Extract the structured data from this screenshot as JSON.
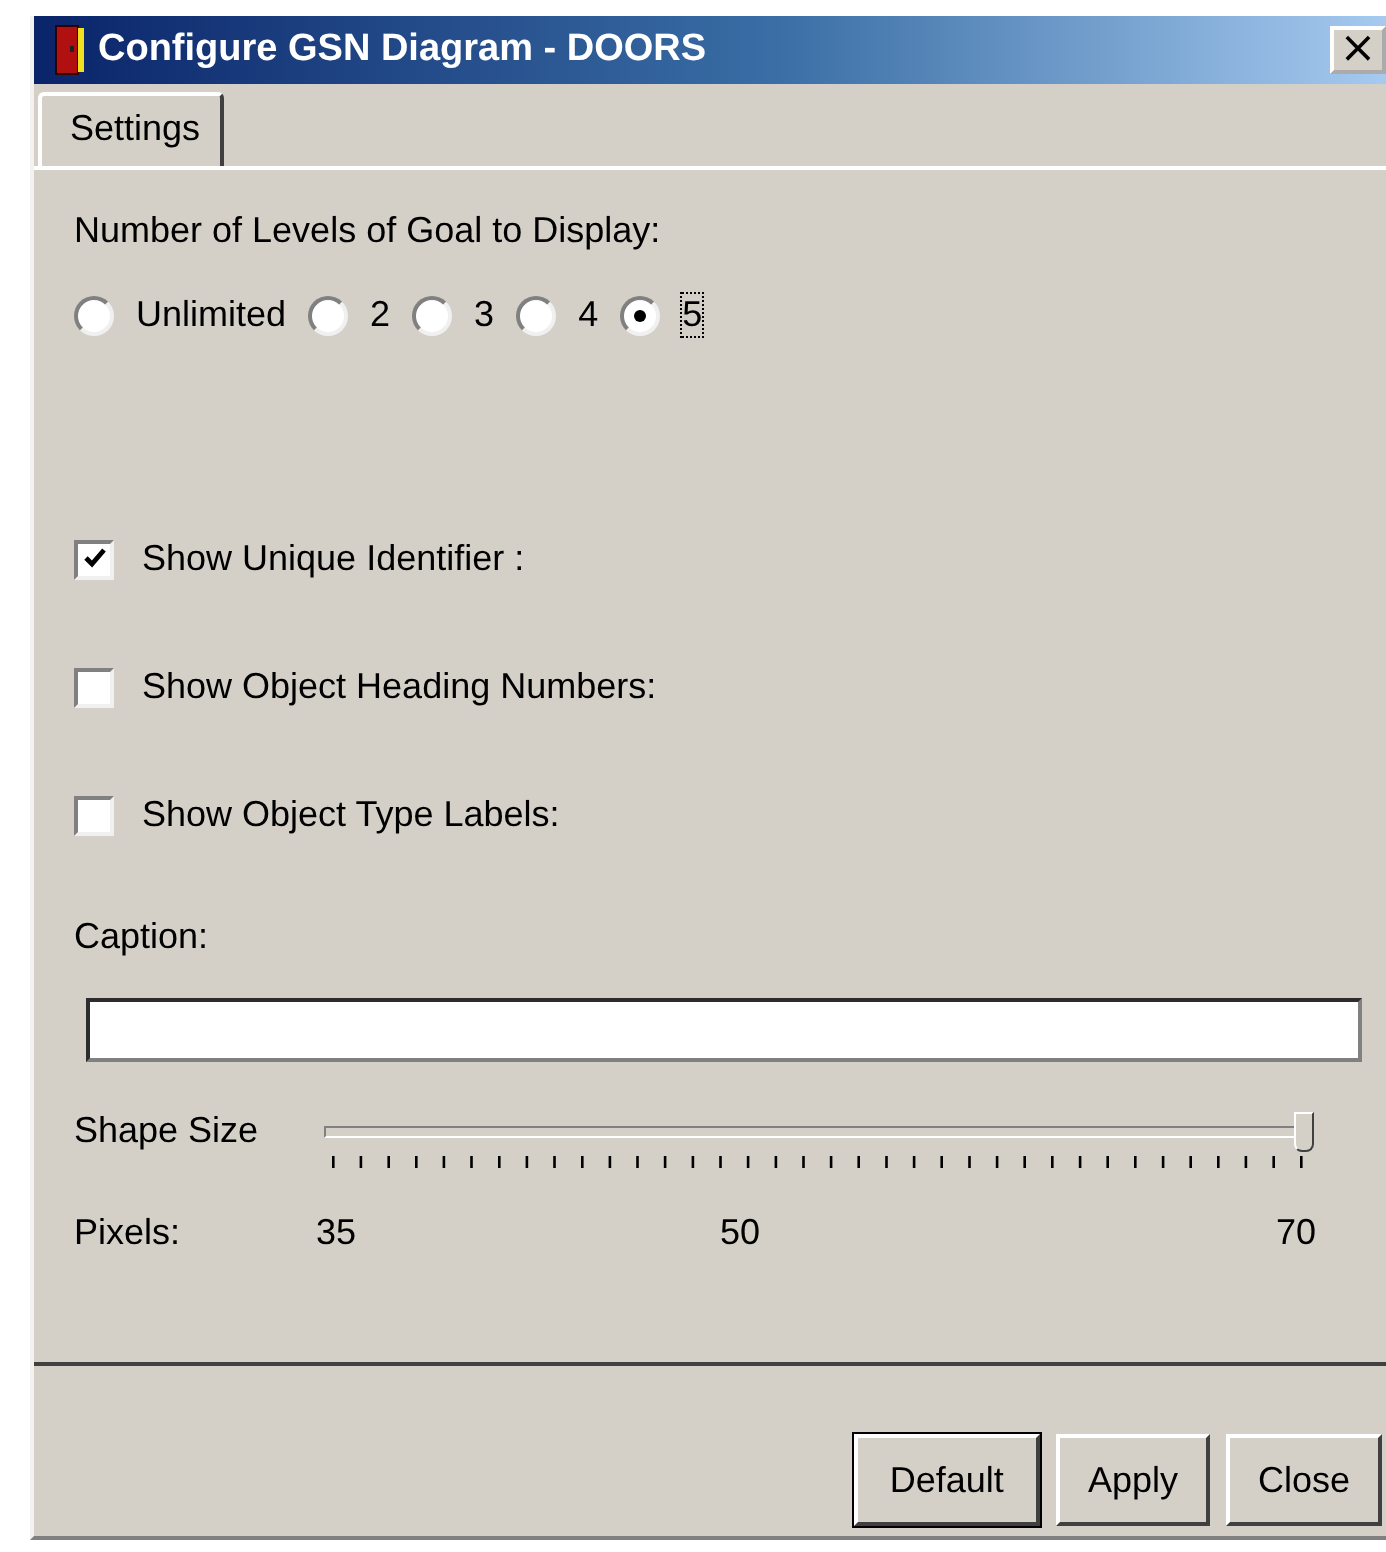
{
  "window": {
    "title": "Configure GSN Diagram - DOORS",
    "close": "×"
  },
  "tabs": [
    {
      "label": "Settings",
      "selected": true
    }
  ],
  "levels": {
    "label": "Number of Levels of Goal to Display:",
    "options": [
      {
        "label": "Unlimited",
        "selected": false
      },
      {
        "label": "2",
        "selected": false
      },
      {
        "label": "3",
        "selected": false
      },
      {
        "label": "4",
        "selected": false
      },
      {
        "label": "5",
        "selected": true
      }
    ]
  },
  "checkboxes": [
    {
      "label": "Show Unique Identifier :",
      "checked": true
    },
    {
      "label": "Show Object Heading Numbers:",
      "checked": false
    },
    {
      "label": "Show Object Type Labels:",
      "checked": false
    }
  ],
  "caption": {
    "label": "Caption:"
  },
  "shape_size": {
    "label": "Shape Size",
    "level": 1.0,
    "scale_label": "Pixels:",
    "scale": [
      "35",
      "50",
      "70"
    ]
  },
  "buttons": [
    {
      "label": "Default",
      "default": true
    },
    {
      "label": "Apply",
      "default": false
    },
    {
      "label": "Close",
      "default": false
    }
  ]
}
